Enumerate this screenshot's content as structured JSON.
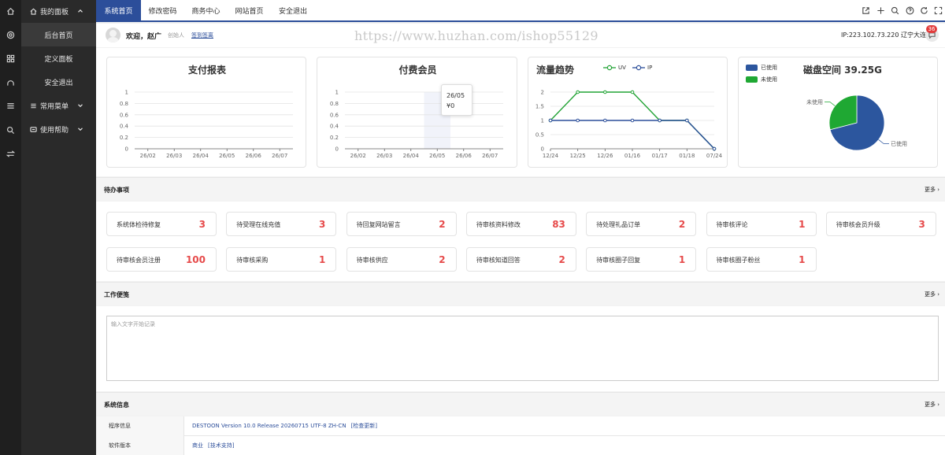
{
  "rail_icons": [
    "home-icon",
    "target-icon",
    "grid-icon",
    "user-icon",
    "menu-icon",
    "search-icon",
    "swap-icon"
  ],
  "sidebar": {
    "group_main": "我的面板",
    "items": [
      {
        "label": "后台首页",
        "active": true
      },
      {
        "label": "定义面板",
        "active": false
      },
      {
        "label": "安全退出",
        "active": false
      }
    ],
    "group_common": "常用菜单",
    "group_help": "使用帮助"
  },
  "topbar": {
    "tabs": [
      {
        "label": "系统首页",
        "active": true
      },
      {
        "label": "修改密码",
        "active": false
      },
      {
        "label": "商务中心",
        "active": false
      },
      {
        "label": "网站首页",
        "active": false
      },
      {
        "label": "安全退出",
        "active": false
      }
    ],
    "icons": [
      "external-link-icon",
      "plus-icon",
      "search-icon",
      "help-icon",
      "refresh-icon",
      "fullscreen-icon"
    ]
  },
  "welcome": {
    "greeting": "欢迎，赵广",
    "role": "创始人",
    "sign_link": "签到签离",
    "watermark": "https://www.huzhan.com/ishop55129",
    "ip": "IP:223.102.73.220 辽宁大连",
    "badge": "36"
  },
  "charts": {
    "payment": {
      "title": "支付报表"
    },
    "member": {
      "title": "付费会员",
      "tooltip_date": "26/05",
      "tooltip_value": "¥0"
    },
    "traffic": {
      "title": "流量趋势",
      "legend_uv": "UV",
      "legend_ip": "IP"
    },
    "disk": {
      "title": "磁盘空间 39.25G",
      "legend_used": "已使用",
      "legend_free": "未使用",
      "label_used": "已使用",
      "label_free": "未使用"
    }
  },
  "chart_data": [
    {
      "type": "line",
      "title": "支付报表",
      "categories": [
        "26/02",
        "26/03",
        "26/04",
        "26/05",
        "26/06",
        "26/07"
      ],
      "values": [
        0,
        0,
        0,
        0,
        0,
        0
      ],
      "y_ticks": [
        "1",
        "0.8",
        "0.6",
        "0.4",
        "0.2",
        "0"
      ],
      "ylim": [
        0,
        1
      ]
    },
    {
      "type": "line",
      "title": "付费会员",
      "categories": [
        "26/02",
        "26/03",
        "26/04",
        "26/05",
        "26/06",
        "26/07"
      ],
      "values": [
        0,
        0,
        0,
        0,
        0,
        0
      ],
      "y_ticks": [
        "1",
        "0.8",
        "0.6",
        "0.4",
        "0.2",
        "0"
      ],
      "ylim": [
        0,
        1
      ]
    },
    {
      "type": "line",
      "title": "流量趋势",
      "categories": [
        "12/24",
        "12/25",
        "12/26",
        "01/16",
        "01/17",
        "01/18",
        "07/24"
      ],
      "series": [
        {
          "name": "UV",
          "values": [
            1,
            2,
            2,
            2,
            1,
            1,
            0
          ],
          "color": "#22a335"
        },
        {
          "name": "IP",
          "values": [
            1,
            1,
            1,
            1,
            1,
            1,
            0
          ],
          "color": "#2c4e9a"
        }
      ],
      "y_ticks": [
        "2",
        "1.5",
        "1",
        "0.5",
        "0"
      ],
      "ylim": [
        0,
        2
      ]
    },
    {
      "type": "pie",
      "title": "磁盘空间 39.25G",
      "slices": [
        {
          "name": "已使用",
          "value": 71,
          "color": "#2c569e"
        },
        {
          "name": "未使用",
          "value": 29,
          "color": "#1fa833"
        }
      ]
    }
  ],
  "todo": {
    "title": "待办事项",
    "more": "更多",
    "items": [
      {
        "label": "系统体检待修复",
        "count": "3"
      },
      {
        "label": "待受理在线充值",
        "count": "3"
      },
      {
        "label": "待回复网站留言",
        "count": "2"
      },
      {
        "label": "待审核资料修改",
        "count": "83"
      },
      {
        "label": "待处理礼品订单",
        "count": "2"
      },
      {
        "label": "待审核评论",
        "count": "1"
      },
      {
        "label": "待审核会员升级",
        "count": "3"
      },
      {
        "label": "待审核会员注册",
        "count": "100"
      },
      {
        "label": "待审核采购",
        "count": "1"
      },
      {
        "label": "待审核供应",
        "count": "2"
      },
      {
        "label": "待审核知道回答",
        "count": "2"
      },
      {
        "label": "待审核圈子回复",
        "count": "1"
      },
      {
        "label": "待审核圈子粉丝",
        "count": "1"
      }
    ]
  },
  "notes": {
    "title": "工作便笺",
    "more": "更多",
    "placeholder": "输入文字开始记录"
  },
  "sysinfo": {
    "title": "系统信息",
    "more": "更多",
    "rows": [
      {
        "key": "程序信息",
        "value": "DESTOON Version 10.0 Release 20260715 UTF-8 ZH-CN",
        "link": "[检查更新]"
      },
      {
        "key": "软件版本",
        "value": "商业",
        "link": "[技术支持]"
      }
    ]
  }
}
